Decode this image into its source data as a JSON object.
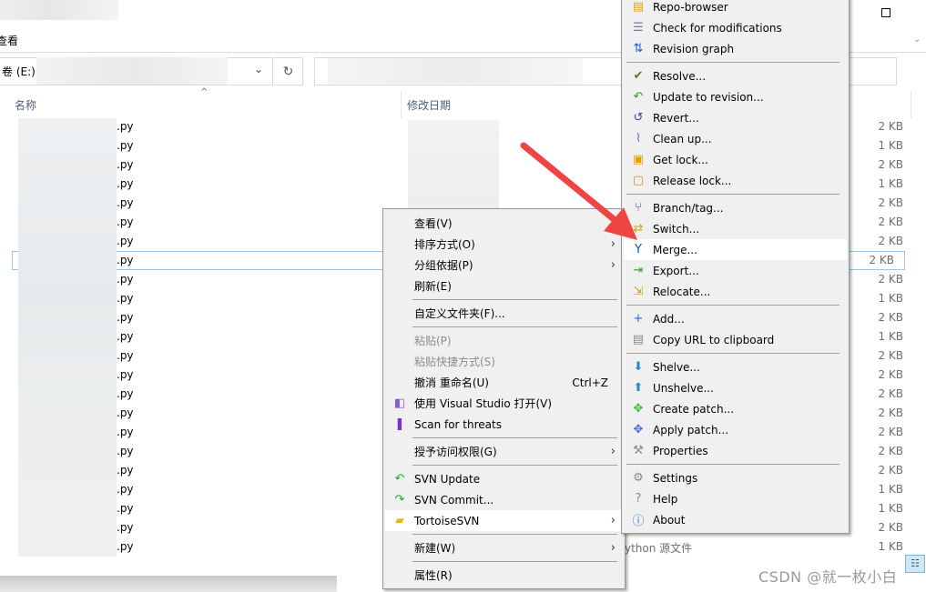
{
  "window": {
    "ribbon_tab": "查看",
    "address_prefix": "卷 (E:)",
    "address_sep": "›",
    "refresh_icon": "↻",
    "dropdown_icon": "⌄",
    "maximize_icon": "square",
    "ribbon_expand_icon": "⌄"
  },
  "columns": {
    "name": "名称",
    "date": "修改日期",
    "sort_indicator": "^"
  },
  "files": [
    {
      "ext": ".py",
      "size": "2 KB"
    },
    {
      "ext": ".py",
      "size": "1 KB"
    },
    {
      "ext": ".py",
      "size": "2 KB"
    },
    {
      "ext": ".py",
      "size": "1 KB"
    },
    {
      "ext": ".py",
      "size": "2 KB"
    },
    {
      "ext": ".py",
      "size": "2 KB"
    },
    {
      "ext": ".py",
      "size": "2 KB"
    },
    {
      "ext": ".py",
      "size": "2 KB",
      "selected": true
    },
    {
      "ext": ".py",
      "size": "2 KB"
    },
    {
      "ext": ".py",
      "size": "1 KB"
    },
    {
      "ext": ".py",
      "size": "2 KB"
    },
    {
      "ext": ".py",
      "size": "1 KB"
    },
    {
      "ext": ".py",
      "size": "2 KB"
    },
    {
      "ext": ".py",
      "size": "2 KB"
    },
    {
      "ext": ".py",
      "size": "2 KB"
    },
    {
      "ext": ".py",
      "size": "2 KB"
    },
    {
      "ext": ".py",
      "size": "2 KB"
    },
    {
      "ext": ".py",
      "size": "2 KB"
    },
    {
      "ext": ".py",
      "size": "2 KB"
    },
    {
      "ext": ".py",
      "size": "1 KB"
    },
    {
      "ext": ".py",
      "size": "1 KB"
    },
    {
      "ext": ".py",
      "size": "2 KB"
    },
    {
      "ext": ".py",
      "size": "1 KB"
    }
  ],
  "last_row_type": "ython 源文件",
  "context_menu": {
    "items": [
      {
        "label": "查看(V)"
      },
      {
        "label": "排序方式(O)",
        "submenu": true
      },
      {
        "label": "分组依据(P)",
        "submenu": true
      },
      {
        "label": "刷新(E)"
      },
      {
        "separator": true
      },
      {
        "label": "自定义文件夹(F)..."
      },
      {
        "separator": true
      },
      {
        "label": "粘贴(P)",
        "disabled": true
      },
      {
        "label": "粘贴快捷方式(S)",
        "disabled": true
      },
      {
        "label": "撤消 重命名(U)",
        "shortcut": "Ctrl+Z"
      },
      {
        "label": "使用 Visual Studio 打开(V)",
        "icon": "visual-studio-icon"
      },
      {
        "label": "Scan for threats",
        "icon": "scan-threats-icon"
      },
      {
        "separator": true
      },
      {
        "label": "授予访问权限(G)",
        "submenu": true
      },
      {
        "separator": true
      },
      {
        "label": "SVN Update",
        "icon": "svn-update-icon"
      },
      {
        "label": "SVN Commit...",
        "icon": "svn-commit-icon"
      },
      {
        "label": "TortoiseSVN",
        "icon": "tortoisesvn-icon",
        "submenu": true,
        "highlighted": true
      },
      {
        "separator": true
      },
      {
        "label": "新建(W)",
        "submenu": true
      },
      {
        "separator": true
      },
      {
        "label": "属性(R)"
      }
    ]
  },
  "svn_menu": {
    "items": [
      {
        "label": "Repo-browser",
        "icon": "repo-browser-icon"
      },
      {
        "label": "Check for modifications",
        "icon": "check-modifications-icon"
      },
      {
        "label": "Revision graph",
        "icon": "revision-graph-icon"
      },
      {
        "separator": true
      },
      {
        "label": "Resolve...",
        "icon": "resolve-icon"
      },
      {
        "label": "Update to revision...",
        "icon": "update-revision-icon"
      },
      {
        "label": "Revert...",
        "icon": "revert-icon"
      },
      {
        "label": "Clean up...",
        "icon": "cleanup-icon"
      },
      {
        "label": "Get lock...",
        "icon": "lock-icon"
      },
      {
        "label": "Release lock...",
        "icon": "unlock-icon"
      },
      {
        "separator": true
      },
      {
        "label": "Branch/tag...",
        "icon": "branch-icon"
      },
      {
        "label": "Switch...",
        "icon": "switch-icon"
      },
      {
        "label": "Merge...",
        "icon": "merge-icon",
        "highlighted": true
      },
      {
        "label": "Export...",
        "icon": "export-icon"
      },
      {
        "label": "Relocate...",
        "icon": "relocate-icon"
      },
      {
        "separator": true
      },
      {
        "label": "Add...",
        "icon": "add-icon"
      },
      {
        "label": "Copy URL to clipboard",
        "icon": "copy-url-icon"
      },
      {
        "separator": true
      },
      {
        "label": "Shelve...",
        "icon": "shelve-icon"
      },
      {
        "label": "Unshelve...",
        "icon": "unshelve-icon"
      },
      {
        "label": "Create patch...",
        "icon": "create-patch-icon"
      },
      {
        "label": "Apply patch...",
        "icon": "apply-patch-icon"
      },
      {
        "label": "Properties",
        "icon": "properties-icon"
      },
      {
        "separator": true
      },
      {
        "label": "Settings",
        "icon": "settings-icon"
      },
      {
        "label": "Help",
        "icon": "help-icon"
      },
      {
        "label": "About",
        "icon": "about-icon"
      }
    ]
  },
  "annotation": {
    "arrow_color": "#ee4444",
    "points_to": "Merge..."
  },
  "watermark": "CSDN @就一枚小白",
  "colors": {
    "menu_bg": "#f0f0f0",
    "menu_highlight": "#ffffff",
    "selection_border": "#99c9e0",
    "header_text": "#4c607a",
    "size_text": "#6d6d6d"
  }
}
